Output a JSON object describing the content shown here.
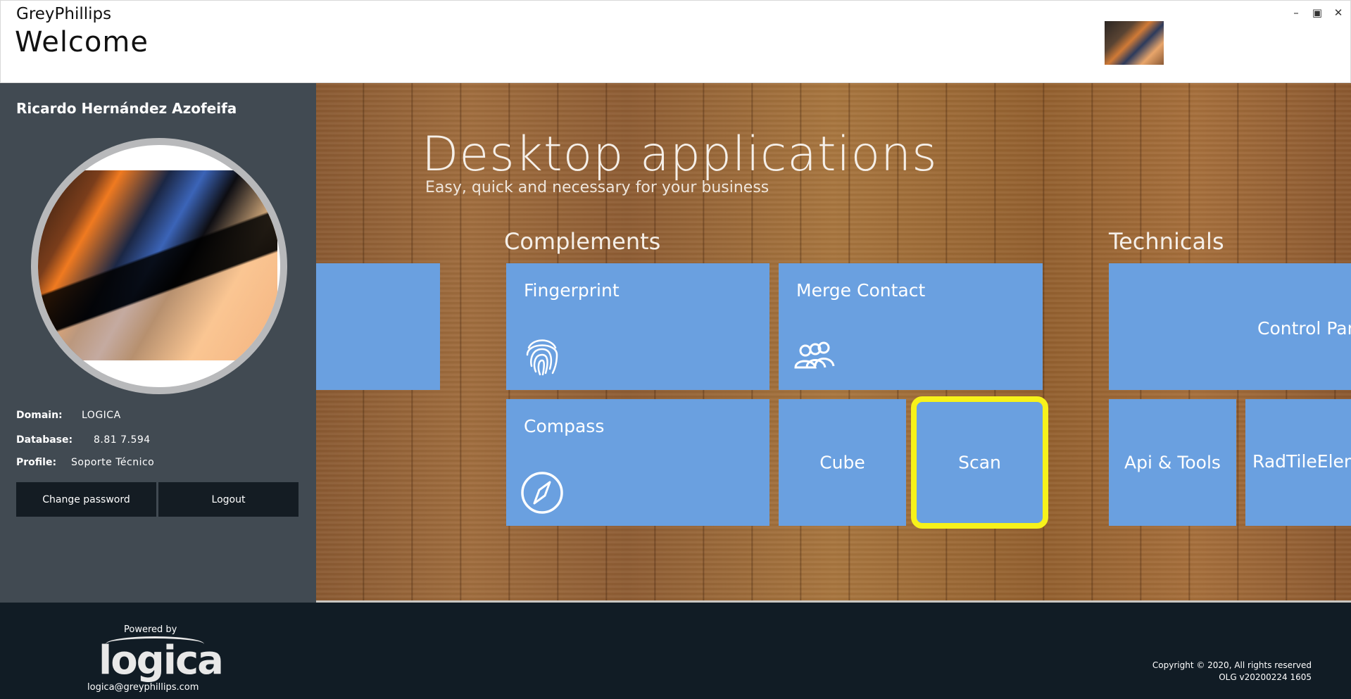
{
  "window": {
    "app_name": "GreyPhillips",
    "page_title": "Welcome",
    "minimize": "–",
    "maximize": "▣",
    "close": "✕"
  },
  "sidebar": {
    "user_name": "Ricardo Hernández Azofeifa",
    "domain_label": "Domain:",
    "domain_value": "LOGICA",
    "database_label": "Database:",
    "database_value": "8.81 7.594",
    "profile_label": "Profile:",
    "profile_value": "Soporte Técnico",
    "change_password": "Change password",
    "logout": "Logout"
  },
  "main": {
    "title": "Desktop applications",
    "subtitle": "Easy, quick and necessary for your business",
    "groups": [
      {
        "title": "Complements",
        "tiles": [
          {
            "label": "Fingerprint",
            "icon": "fingerprint-icon"
          },
          {
            "label": "Merge Contact",
            "icon": "users-icon"
          },
          {
            "label": "Compass",
            "icon": "compass-icon"
          },
          {
            "label": "Cube"
          },
          {
            "label": "Scan",
            "selected": true
          }
        ]
      },
      {
        "title": "Technicals",
        "tiles": [
          {
            "label": "Control Pane"
          },
          {
            "label": "Api & Tools"
          },
          {
            "label": "RadTileEleme"
          }
        ]
      }
    ],
    "tile_color": "#6aa0e0",
    "selection_color": "#f7f21a"
  },
  "footer": {
    "powered_by": "Powered by",
    "logo_text": "logica",
    "email": "logica@greyphillips.com",
    "copyright": "Copyright © 2020, All rights reserved",
    "version": "OLG v20200224  1605"
  }
}
